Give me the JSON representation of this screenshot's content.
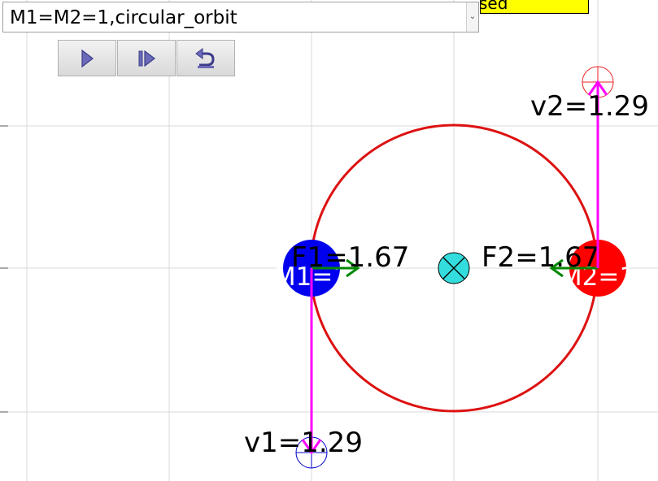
{
  "preset_select": {
    "selected": "M1=M2=1,circular_orbit"
  },
  "status_badge": {
    "text": "sed",
    "color": "#ffff00"
  },
  "toolbar": {
    "buttons": [
      {
        "name": "play",
        "icon": "play-icon"
      },
      {
        "name": "step",
        "icon": "step-forward-icon"
      },
      {
        "name": "reset",
        "icon": "reset-icon"
      }
    ]
  },
  "simulation": {
    "body1": {
      "label": "M1=1",
      "color": "#0000ee",
      "force_label": "F1=1.67",
      "velocity_label": "v1=1.29"
    },
    "body2": {
      "label": "M2=1",
      "color": "#ff0000",
      "force_label": "F2=1.67",
      "velocity_label": "v2=1.29"
    },
    "orbit_color": "#dd1111",
    "center_of_mass_color": "#33dddd",
    "force_arrow_color": "#008800",
    "velocity_arrow_color": "#ff00ff",
    "grid_color": "#d9d9d9"
  }
}
